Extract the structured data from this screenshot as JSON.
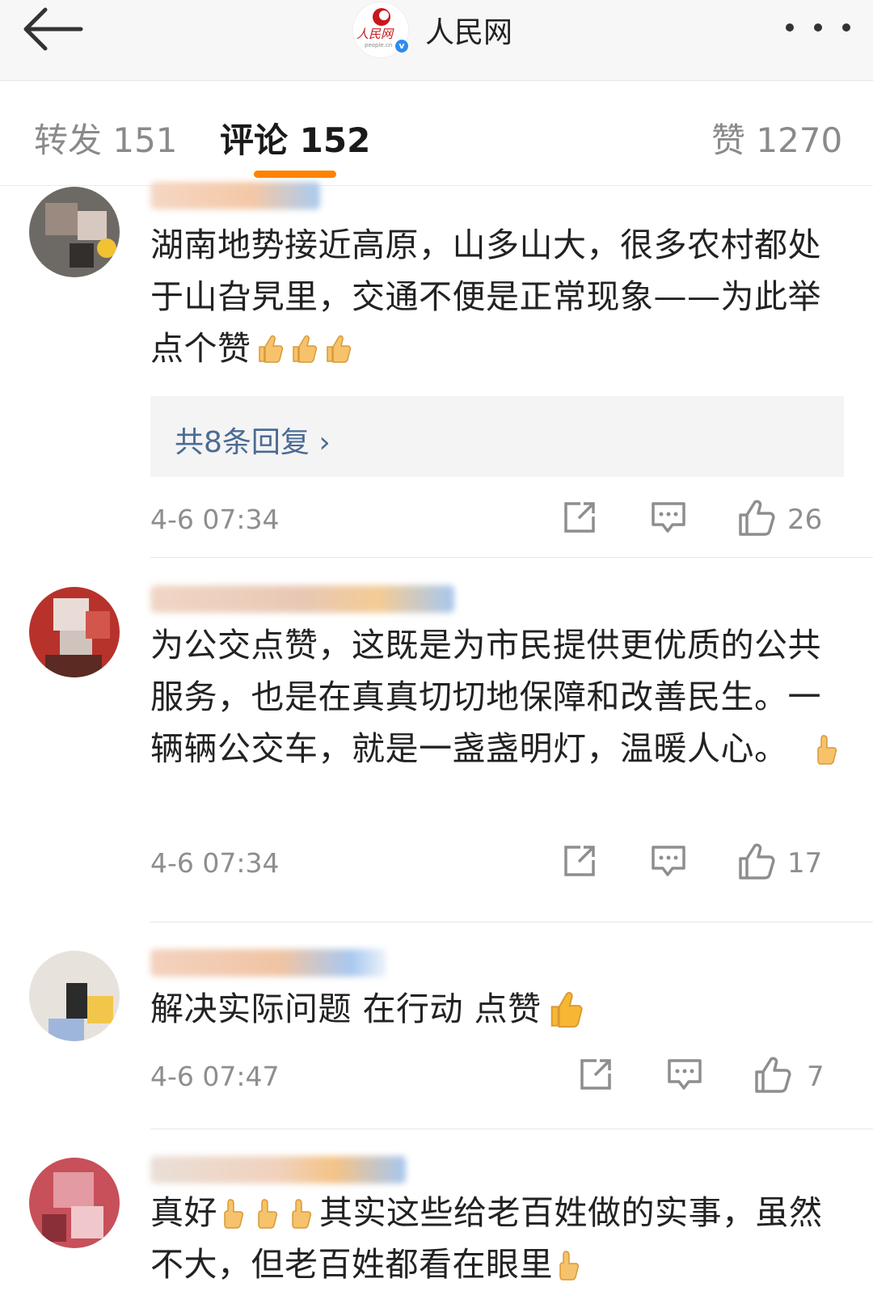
{
  "header": {
    "account_name": "人民网",
    "logo_text": "人民网",
    "logo_sub": "people.cn",
    "verified_mark": "v",
    "back_icon": "arrow-left-icon",
    "more_icon": "more-dots-icon"
  },
  "tabs": [
    {
      "label": "转发 151",
      "active": false
    },
    {
      "label": "评论 152",
      "active": true
    },
    {
      "label": "赞 1270",
      "active": false
    }
  ],
  "colors": {
    "accent": "#ff8200",
    "link": "#4b6b93",
    "muted": "#8e8e8e"
  },
  "comments": [
    {
      "text": "湖南地势接近高原，山多山大，很多农村都处于山旮旯里，交通不便是正常现象——为此举点个赞",
      "emoji": [
        "thumbs-up",
        "thumbs-up",
        "thumbs-up"
      ],
      "reply_link": "共8条回复 ›",
      "time": "4-6 07:34",
      "likes": "26"
    },
    {
      "text": "为公交点赞，这既是为市民提供更优质的公共服务，也是在真真切切地保障和改善民生。一辆辆公交车，就是一盏盏明灯，温暖人心。",
      "emoji": [
        "thumbs-up"
      ],
      "time": "4-6 07:34",
      "likes": "17"
    },
    {
      "text": "解决实际问题 在行动 点赞",
      "emoji": [
        "thumbs-up"
      ],
      "time": "4-6 07:47",
      "likes": "7"
    },
    {
      "text_part1": "真好",
      "text_part2": "其实这些给老百姓做的实事，虽然不大，但老百姓都看在眼里",
      "emoji": [
        "thumbs-up",
        "thumbs-up",
        "thumbs-up",
        "thumbs-up"
      ]
    }
  ]
}
